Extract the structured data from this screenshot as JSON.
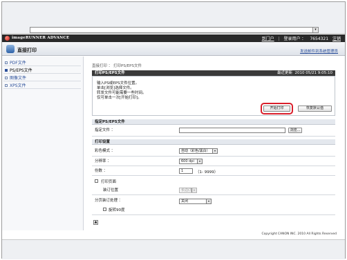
{
  "browser": {
    "address": ""
  },
  "header": {
    "brand": "imageRUNNER ADVANCE",
    "portal_link": "到门户",
    "login_label": "登录用户 ：",
    "user_id": "7654321",
    "logout_link": "注销"
  },
  "title_bar": {
    "title": "直接打印",
    "mail_link": "发送邮件到系统管理员"
  },
  "sidebar": {
    "items": [
      {
        "label": "PDF文件",
        "active": false
      },
      {
        "label": "PS/EPS文件",
        "active": true
      },
      {
        "label": "图像文件",
        "active": false
      },
      {
        "label": "XPS文件",
        "active": false
      }
    ]
  },
  "breadcrumb": "直接打印 ： 打印PS/EPS文件",
  "print_section": {
    "title": "打印PS/EPS文件",
    "updated_label": "最近更新",
    "updated_time": "2010 05/21 9:05:10",
    "instructions": [
      "输入PS或EPS文件位置。",
      "单击[浏览]选择文件。",
      "转发文件可能需要一些时间。",
      "仅可单击一次[开始打印]。"
    ],
    "start_button": "开始打印",
    "restore_button": "恢复默认值"
  },
  "file_section": {
    "title": "指定PS/EPS文件",
    "file_label": "指定文件 ：",
    "file_value": "",
    "browse_button": "浏览..."
  },
  "settings_section": {
    "title": "打印设置",
    "color_mode_label": "彩色模式 ：",
    "color_mode_value": "自动（彩色/黑白）",
    "resolution_label": "分辨率 ：",
    "resolution_value": "600 dpi",
    "copies_label": "份数 ：",
    "copies_value": "1",
    "copies_range": "（1- 9999）",
    "booklet_label": "打印页面",
    "binding_label": "装订位置",
    "binding_value": "长边(左)",
    "collate_label": "分页装订处理 ：",
    "collate_value": "关闭",
    "rotate_label": "旋转90度"
  },
  "footer": {
    "copyright": "Copyright CANON INC. 2010 All Rights Reserved"
  }
}
